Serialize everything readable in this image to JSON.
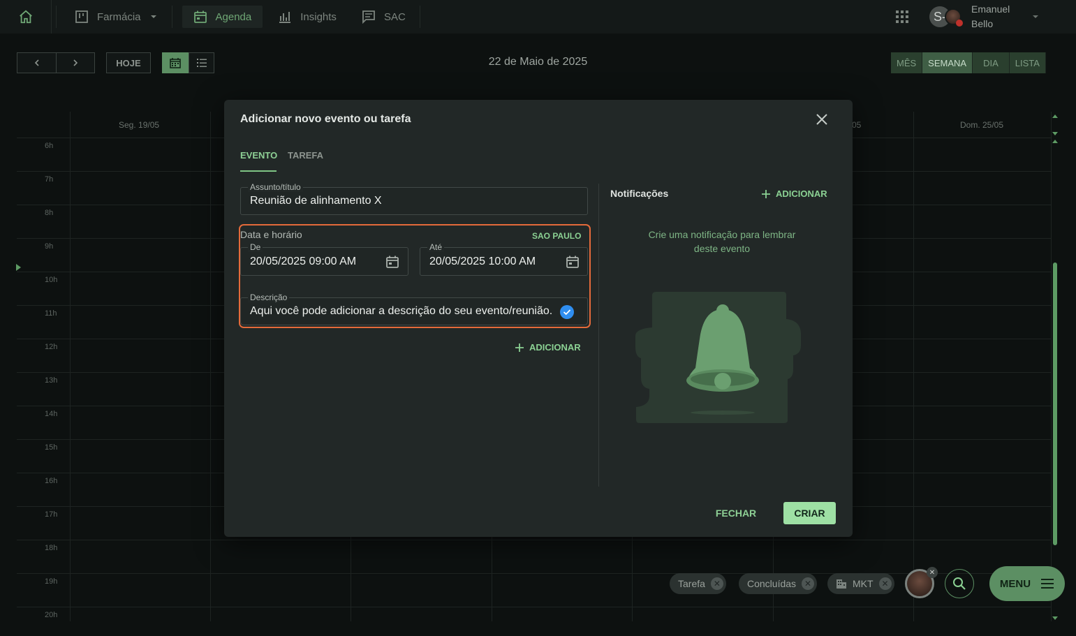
{
  "nav": {
    "items": [
      {
        "label": "Farmácia",
        "icon": "board-icon"
      },
      {
        "label": "Agenda",
        "icon": "calendar-icon"
      },
      {
        "label": "Insights",
        "icon": "bar-chart-icon"
      },
      {
        "label": "SAC",
        "icon": "chat-icon"
      }
    ],
    "user": {
      "initial": "S-",
      "first_name": "Emanuel",
      "last_name": "Bello"
    }
  },
  "toolbar": {
    "today_label": "HOJE",
    "date_title": "22 de Maio de 2025",
    "views": [
      "MÊS",
      "SEMANA",
      "DIA",
      "LISTA"
    ],
    "selected_view": "SEMANA"
  },
  "calendar": {
    "days": [
      "Seg. 19/05",
      "05",
      "Dom. 25/05"
    ],
    "hours": [
      "6h",
      "7h",
      "8h",
      "9h",
      "10h",
      "11h",
      "12h",
      "13h",
      "14h",
      "15h",
      "16h",
      "17h",
      "18h",
      "19h",
      "20h"
    ]
  },
  "modal": {
    "title": "Adicionar novo evento ou tarefa",
    "tabs": [
      "EVENTO",
      "TAREFA"
    ],
    "active_tab": "EVENTO",
    "subject": {
      "label": "Assunto/título",
      "value": "Reunião de alinhamento X"
    },
    "datetime": {
      "section_label": "Data e horário",
      "timezone": "SAO PAULO",
      "from": {
        "label": "De",
        "value": "20/05/2025 09:00 AM"
      },
      "to": {
        "label": "Até",
        "value": "20/05/2025 10:00 AM"
      }
    },
    "description": {
      "label": "Descrição",
      "value": "Aqui você pode adicionar a descrição do seu evento/reunião."
    },
    "add_label": "ADICIONAR",
    "notifications": {
      "title": "Notificações",
      "add_label": "ADICIONAR",
      "hint": "Crie uma notificação para lembrar deste evento"
    },
    "close_label": "FECHAR",
    "create_label": "CRIAR"
  },
  "filters": [
    {
      "label": "Tarefa"
    },
    {
      "label": "Concluídas"
    },
    {
      "label": "MKT",
      "icon": "building-icon"
    }
  ],
  "menu_label": "MENU",
  "colors": {
    "accent": "#9ee0a4",
    "highlight": "#e46a3a",
    "modal_bg": "#222827"
  }
}
